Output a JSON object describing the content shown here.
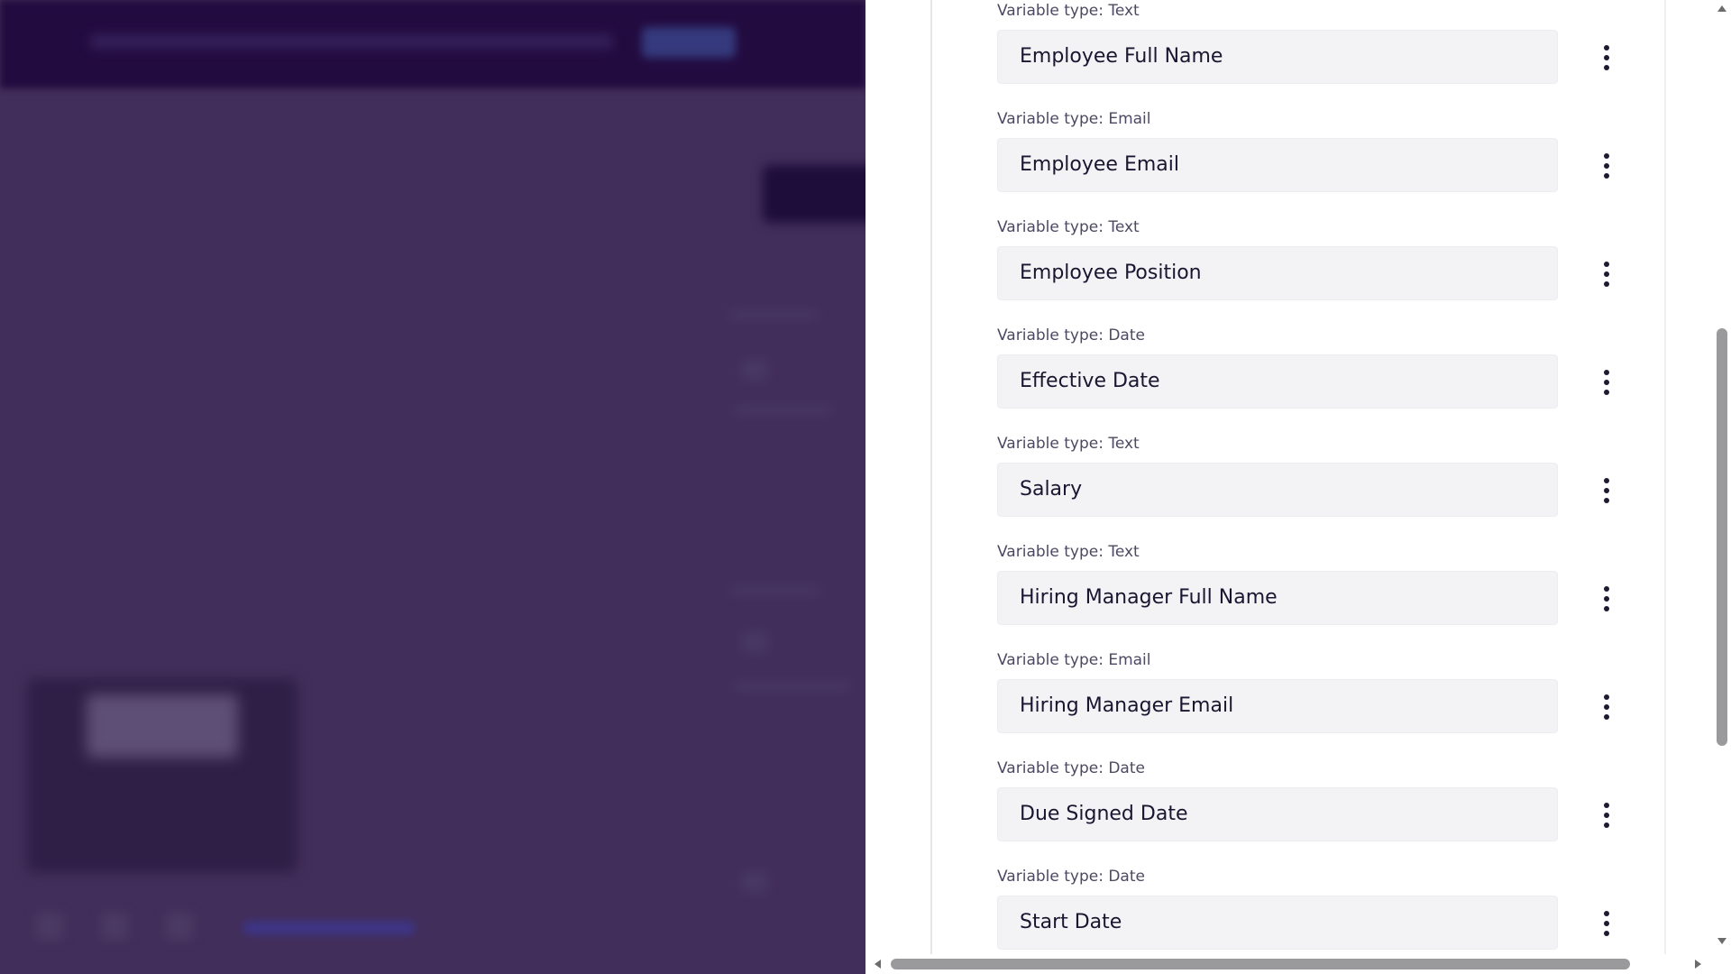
{
  "variables": [
    {
      "type_label": "Variable type: Text",
      "name": "Employee Full Name"
    },
    {
      "type_label": "Variable type: Email",
      "name": "Employee Email"
    },
    {
      "type_label": "Variable type: Text",
      "name": "Employee Position"
    },
    {
      "type_label": "Variable type: Date",
      "name": "Effective Date"
    },
    {
      "type_label": "Variable type: Text",
      "name": "Salary"
    },
    {
      "type_label": "Variable type: Text",
      "name": "Hiring Manager Full Name"
    },
    {
      "type_label": "Variable type: Email",
      "name": "Hiring Manager Email"
    },
    {
      "type_label": "Variable type: Date",
      "name": "Due Signed Date"
    },
    {
      "type_label": "Variable type: Date",
      "name": "Start Date"
    }
  ],
  "icons": {
    "row_menu": "more-vertical-icon"
  },
  "colors": {
    "overlay": "#432f5b",
    "topbar": "#220b3f",
    "field_bg": "#f3f3f5",
    "text": "#1a1530",
    "type_label": "#4e4962"
  }
}
